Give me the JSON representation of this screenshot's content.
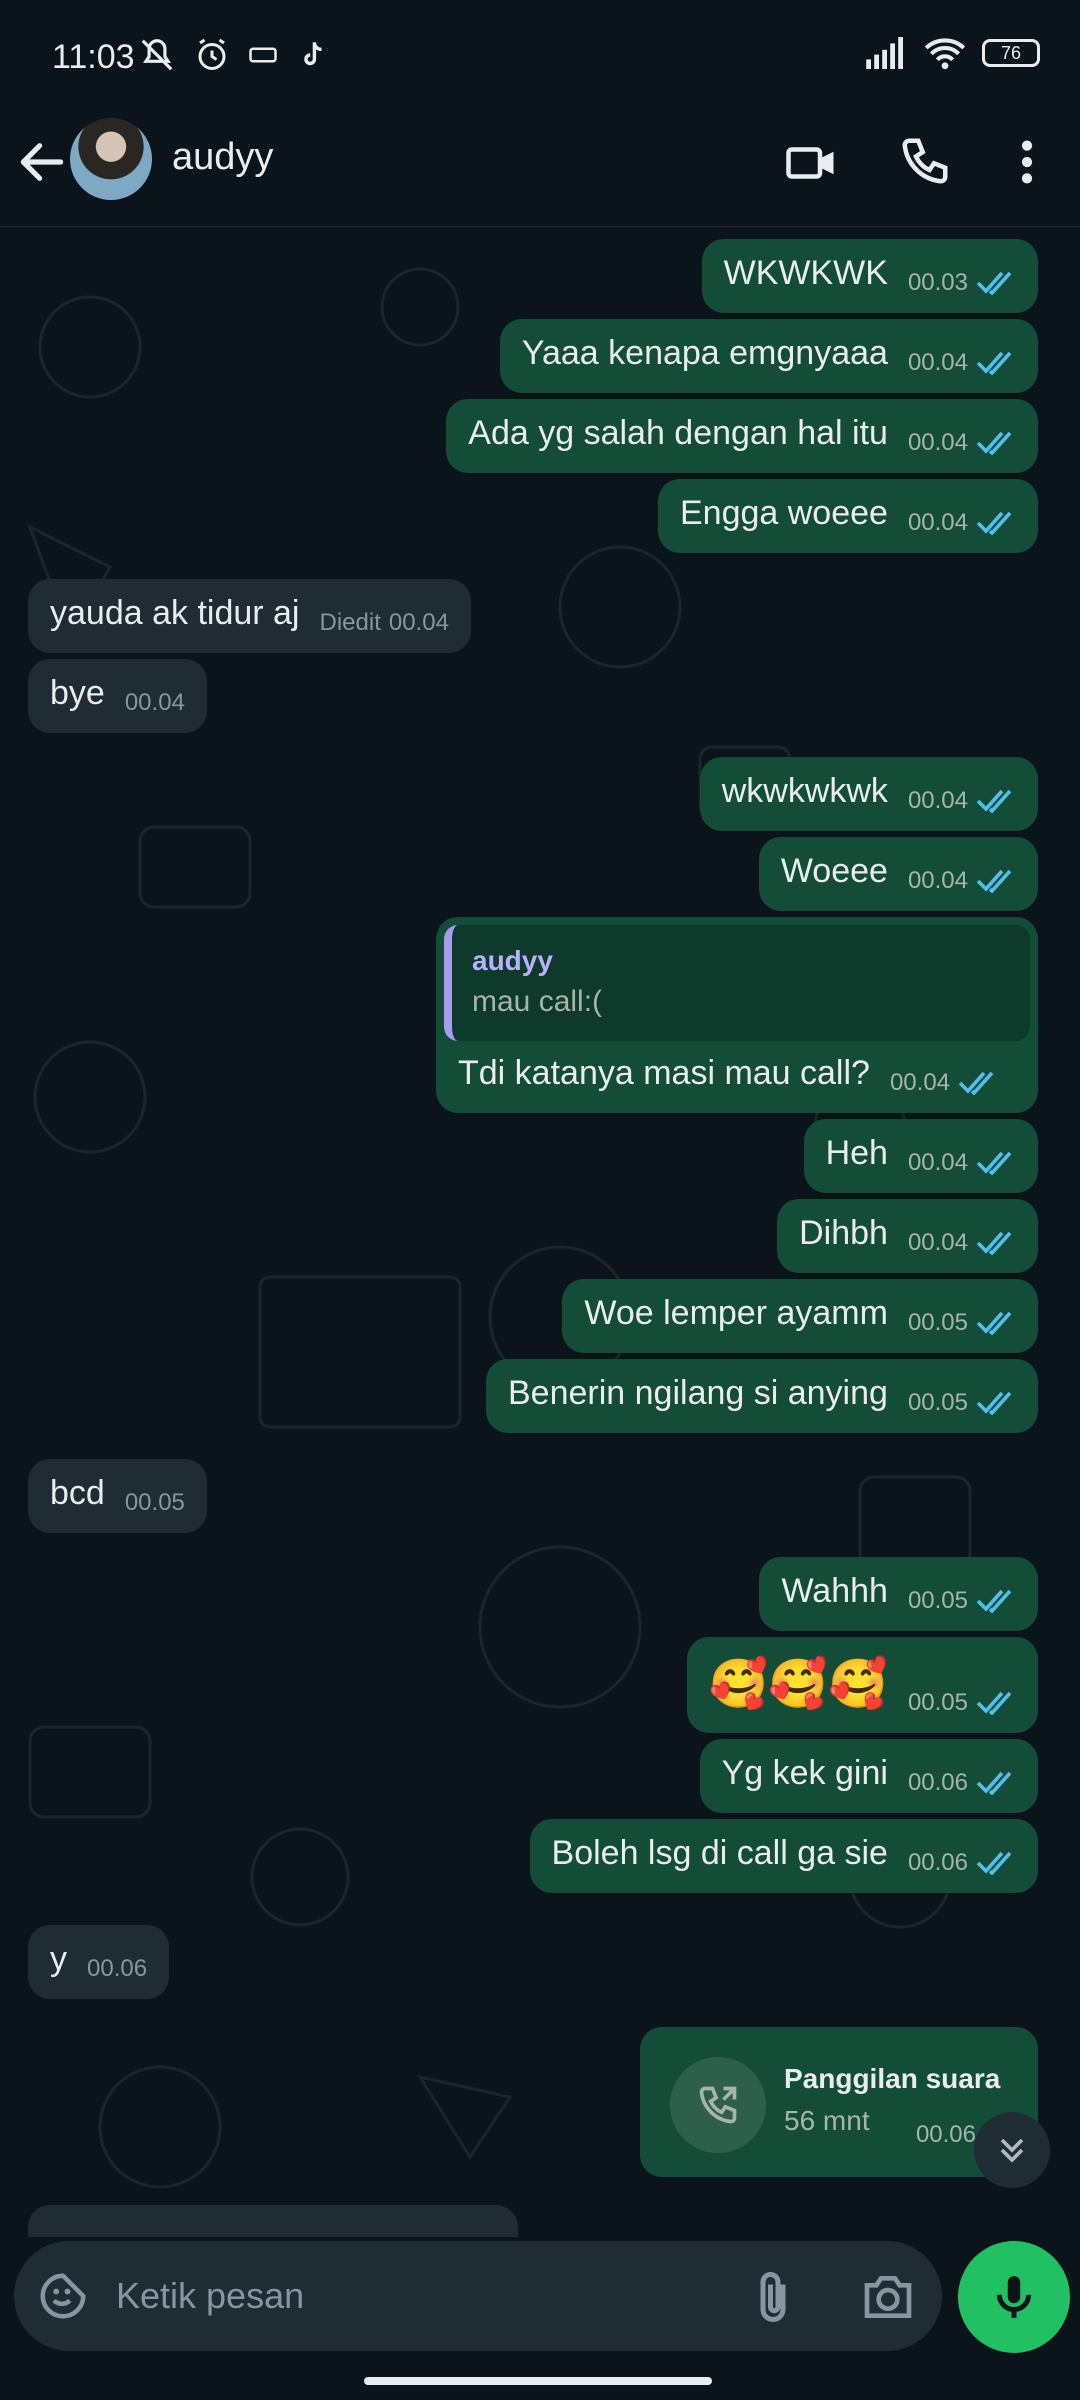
{
  "status_bar": {
    "time": "11:03",
    "battery": "76"
  },
  "header": {
    "contact_name": "audyy"
  },
  "messages": [
    {
      "dir": "out",
      "text": "WKWKWK",
      "time": "00.03"
    },
    {
      "dir": "out",
      "text": "Yaaa kenapa emgnyaaa",
      "time": "00.04"
    },
    {
      "dir": "out",
      "text": "Ada yg salah dengan hal itu",
      "time": "00.04"
    },
    {
      "dir": "out",
      "text": "Engga woeee",
      "time": "00.04"
    },
    {
      "dir": "in",
      "text": "yauda ak tidur aj",
      "edited": "Diedit",
      "time": "00.04"
    },
    {
      "dir": "in",
      "text": "bye",
      "time": "00.04"
    },
    {
      "dir": "out",
      "text": "wkwkwkwk",
      "time": "00.04"
    },
    {
      "dir": "out",
      "text": "Woeee",
      "time": "00.04"
    },
    {
      "dir": "out",
      "reply_to": {
        "name": "audyy",
        "text": "mau call:("
      },
      "text": "Tdi katanya masi mau call?",
      "time": "00.04"
    },
    {
      "dir": "out",
      "text": "Heh",
      "time": "00.04"
    },
    {
      "dir": "out",
      "text": "Dihbh",
      "time": "00.04"
    },
    {
      "dir": "out",
      "text": "Woe lemper ayamm",
      "time": "00.05"
    },
    {
      "dir": "out",
      "text": "Benerin ngilang si anying",
      "time": "00.05"
    },
    {
      "dir": "in",
      "text": "bcd",
      "time": "00.05"
    },
    {
      "dir": "out",
      "text": "Wahhh",
      "time": "00.05"
    },
    {
      "dir": "out",
      "text": "🥰🥰🥰",
      "time": "00.05"
    },
    {
      "dir": "out",
      "text": "Yg kek gini",
      "time": "00.06"
    },
    {
      "dir": "out",
      "text": "Boleh lsg di call ga sie",
      "time": "00.06"
    },
    {
      "dir": "in",
      "text": "y",
      "time": "00.06"
    }
  ],
  "call_message": {
    "title": "Panggilan suara",
    "duration": "56 mnt",
    "time": "00.06"
  },
  "composer": {
    "placeholder": "Ketik pesan"
  },
  "colors": {
    "outgoing_bubble": "#144d37",
    "incoming_bubble": "#202c33",
    "mic_button": "#21c063",
    "read_ticks": "#53bdeb"
  }
}
